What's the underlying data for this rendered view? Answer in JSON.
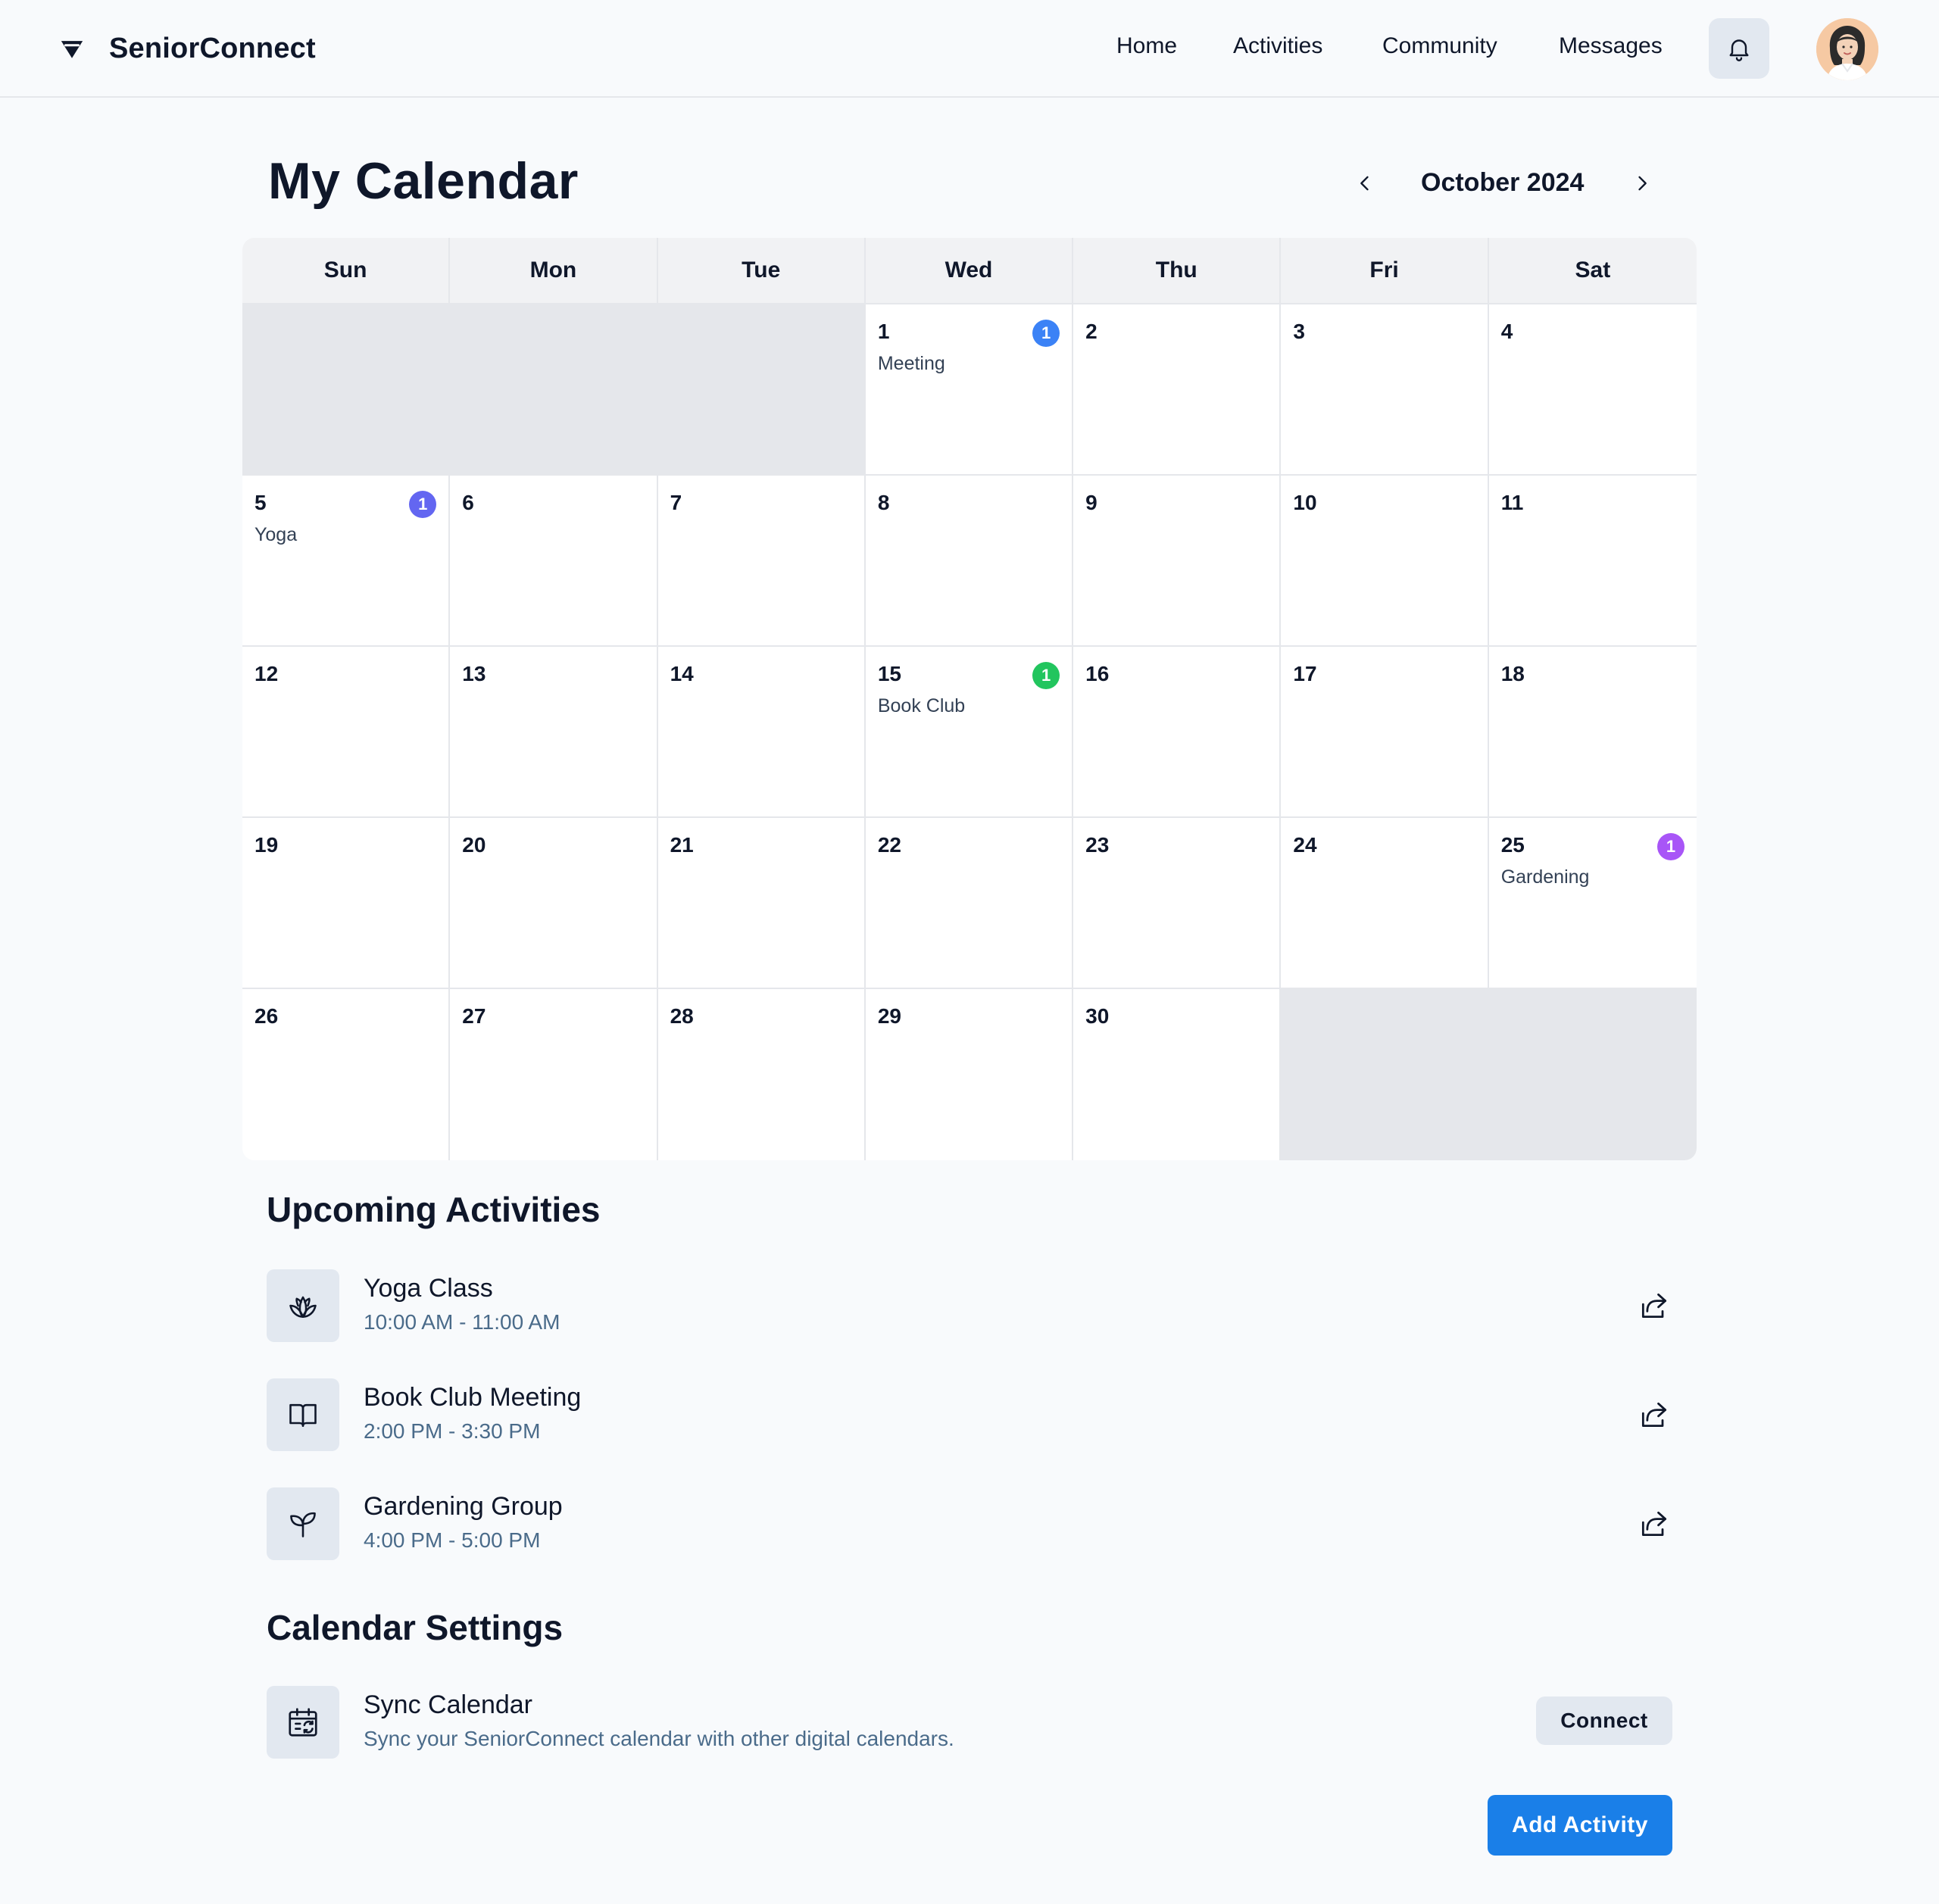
{
  "header": {
    "brand": "SeniorConnect",
    "nav": [
      "Home",
      "Activities",
      "Community",
      "Messages"
    ]
  },
  "page": {
    "title": "My Calendar",
    "month": "October 2024"
  },
  "calendar": {
    "weekdays": [
      "Sun",
      "Mon",
      "Tue",
      "Wed",
      "Thu",
      "Fri",
      "Sat"
    ],
    "leading_empty": 3,
    "days_in_month": 30,
    "events": [
      {
        "day": 1,
        "count": "1",
        "label": "Meeting",
        "color": "#3b82f6"
      },
      {
        "day": 5,
        "count": "1",
        "label": "Yoga",
        "color": "#6366f1"
      },
      {
        "day": 15,
        "count": "1",
        "label": "Book Club",
        "color": "#22c55e"
      },
      {
        "day": 25,
        "count": "1",
        "label": "Gardening",
        "color": "#a855f7"
      }
    ]
  },
  "upcoming": {
    "title": "Upcoming Activities",
    "items": [
      {
        "name": "Yoga Class",
        "time": "10:00 AM - 11:00 AM",
        "icon": "lotus-icon"
      },
      {
        "name": "Book Club Meeting",
        "time": "2:00 PM - 3:30 PM",
        "icon": "book-icon"
      },
      {
        "name": "Gardening Group",
        "time": "4:00 PM - 5:00 PM",
        "icon": "sprout-icon"
      }
    ]
  },
  "settings": {
    "title": "Calendar Settings",
    "sync": {
      "name": "Sync Calendar",
      "description": "Sync your SeniorConnect calendar with other digital calendars.",
      "icon": "calendar-sync-icon",
      "button": "Connect"
    }
  },
  "actions": {
    "add_activity": "Add Activity"
  },
  "colors": {
    "primary": "#1a7fe8",
    "muted_text": "#4a6b8a",
    "empty_cell": "#e5e7eb"
  }
}
